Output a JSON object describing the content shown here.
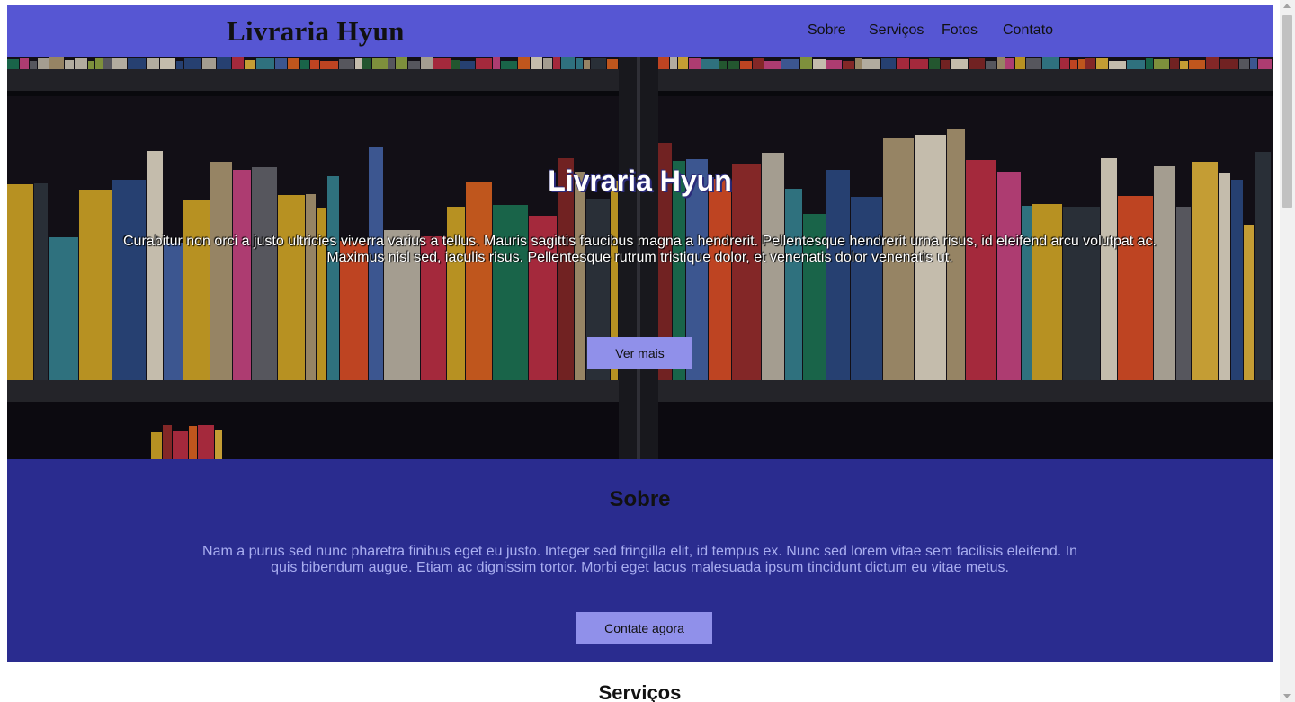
{
  "header": {
    "logo": "Livraria Hyun",
    "nav": [
      "Sobre",
      "Serviços",
      "Fotos",
      "Contato"
    ]
  },
  "hero": {
    "title": "Livraria Hyun",
    "text": "Curabitur non orci a justo ultricies viverra varius a tellus. Mauris sagittis faucibus magna a hendrerit. Pellentesque hendrerit urna risus, id eleifend arcu volutpat ac. Maximus nisl sed, iaculis risus. Pellentesque rutrum tristique dolor, et venenatis dolor venenatis ut.",
    "button": "Ver mais"
  },
  "sobre": {
    "heading": "Sobre",
    "text": "Nam a purus sed nunc pharetra finibus eget eu justo. Integer sed fringilla elit, id tempus ex. Nunc sed lorem vitae sem facilisis eleifend. In quis bibendum augue. Etiam ac dignissim tortor. Morbi eget lacus malesuada ipsum tincidunt dictum eu vitae metus.",
    "button": "Contate agora"
  },
  "servicos": {
    "heading": "Serviços"
  },
  "colors": {
    "navbar": "#5656d3",
    "sobre_bg": "#2a2c8f",
    "button": "#9090ea",
    "sobre_text": "#a9aef0"
  }
}
